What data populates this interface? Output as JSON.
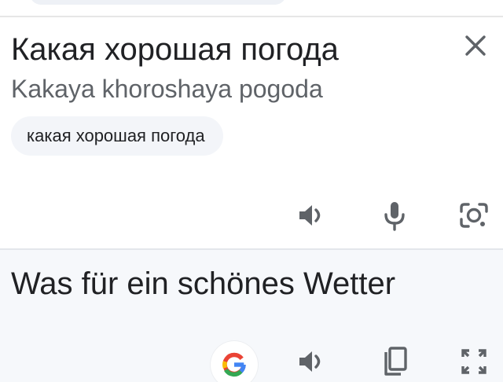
{
  "source": {
    "text": "Какая хорошая погода",
    "transliteration": "Kakaya khoroshaya pogoda",
    "suggestion_chip": "какая хорошая погода",
    "actions": [
      "speaker-icon",
      "microphone-icon",
      "camera-icon"
    ]
  },
  "target": {
    "text": "Was für ein schönes Wetter",
    "actions": [
      "google-icon",
      "speaker-icon",
      "copy-icon",
      "fullscreen-icon"
    ]
  },
  "colors": {
    "icon": "#5f6368",
    "target_background": "#f6f8fb",
    "chip_background": "#f3f5f9",
    "google_blue": "#4285F4",
    "google_red": "#EA4335",
    "google_yellow": "#FBBC05",
    "google_green": "#34A853"
  }
}
